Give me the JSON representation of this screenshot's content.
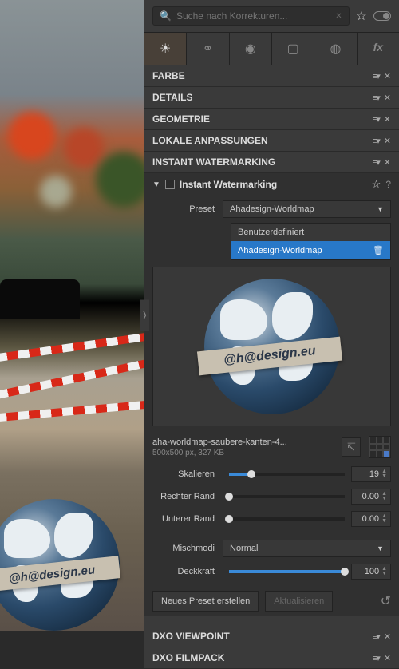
{
  "search": {
    "placeholder": "Suche nach Korrekturen..."
  },
  "tabs_fx": "fx",
  "sections": {
    "farbe": "FARBE",
    "details": "DETAILS",
    "geometrie": "GEOMETRIE",
    "lokale": "LOKALE ANPASSUNGEN",
    "instant": "INSTANT WATERMARKING",
    "viewpoint": "DXO VIEWPOINT",
    "filmpack": "DXO FILMPACK"
  },
  "instant": {
    "title": "Instant Watermarking",
    "preset_label": "Preset",
    "preset_selected": "Ahadesign-Worldmap",
    "options": {
      "benutzer": "Benutzerdefiniert",
      "worldmap": "Ahadesign-Worldmap"
    },
    "ribbon_text": "@h@design.eu",
    "file_name": "aha-worldmap-saubere-kanten-4...",
    "file_meta": "500x500 px,  327 KB",
    "sliders": {
      "skalieren": {
        "label": "Skalieren",
        "value": "19",
        "pct": 19
      },
      "rechter": {
        "label": "Rechter Rand",
        "value": "0.00",
        "pct": 0
      },
      "unterer": {
        "label": "Unterer Rand",
        "value": "0.00",
        "pct": 0
      },
      "deckkraft": {
        "label": "Deckkraft",
        "value": "100",
        "pct": 100
      }
    },
    "mischmodi": {
      "label": "Mischmodi",
      "value": "Normal"
    },
    "buttons": {
      "neues": "Neues Preset erstellen",
      "aktualisieren": "Aktualisieren"
    }
  }
}
